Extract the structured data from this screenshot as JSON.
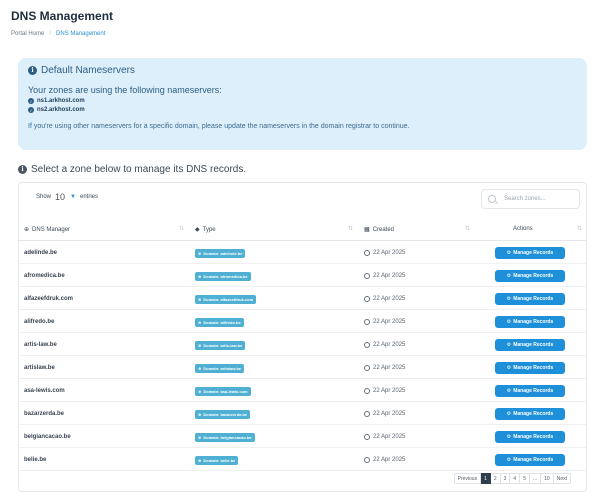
{
  "page": {
    "title": "DNS Management"
  },
  "breadcrumb": {
    "home": "Portal Home",
    "separator": "/",
    "current": "DNS Management"
  },
  "alert": {
    "title": "Default Nameservers",
    "lead": "Your zones are using the following nameservers:",
    "nameservers": [
      "ns1.arkhost.com",
      "ns2.arkhost.com"
    ],
    "note": "If you're using other nameservers for a specific domain, please update the nameservers in the domain registrar to continue."
  },
  "zones": {
    "heading": "Select a zone below to manage its DNS records.",
    "show_label": "Show",
    "entries_value": "10",
    "entries_label": "entries",
    "search_placeholder": "Search zones...",
    "columns": [
      "DNS Manager",
      "Type",
      "Created",
      "Actions"
    ],
    "badge_prefix": "Domain:",
    "button_label": "Manage Records",
    "rows": [
      {
        "domain": "adelinde.be",
        "badge": "Domain: adelinde.be",
        "created": "22 Apr 2025"
      },
      {
        "domain": "afromedica.be",
        "badge": "Domain: afromedica.be",
        "created": "22 Apr 2025"
      },
      {
        "domain": "alfazeefdruk.com",
        "badge": "Domain: alfazeefdruk.com",
        "created": "22 Apr 2025"
      },
      {
        "domain": "alifredo.be",
        "badge": "Domain: alifredo.be",
        "created": "22 Apr 2025"
      },
      {
        "domain": "artis-law.be",
        "badge": "Domain: artis-law.be",
        "created": "22 Apr 2025"
      },
      {
        "domain": "artislaw.be",
        "badge": "Domain: artislaw.be",
        "created": "22 Apr 2025"
      },
      {
        "domain": "asa-lewis.com",
        "badge": "Domain: asa-lewis.com",
        "created": "22 Apr 2025"
      },
      {
        "domain": "bazarzerda.be",
        "badge": "Domain: bazarzerda.be",
        "created": "22 Apr 2025"
      },
      {
        "domain": "belgiancacao.be",
        "badge": "Domain: belgiancacao.be",
        "created": "22 Apr 2025"
      },
      {
        "domain": "belie.be",
        "badge": "Domain: belie.be",
        "created": "22 Apr 2025"
      }
    ]
  },
  "pagination": {
    "previous": "Previous",
    "pages": [
      "1",
      "2",
      "3",
      "4",
      "5",
      "...",
      "10"
    ],
    "next": "Next",
    "active": "1"
  },
  "colors": {
    "accent": "#1e8fd9",
    "badge": "#4fb0d3",
    "alert_bg": "#dceffb",
    "active_page": "#2f3d4c"
  }
}
